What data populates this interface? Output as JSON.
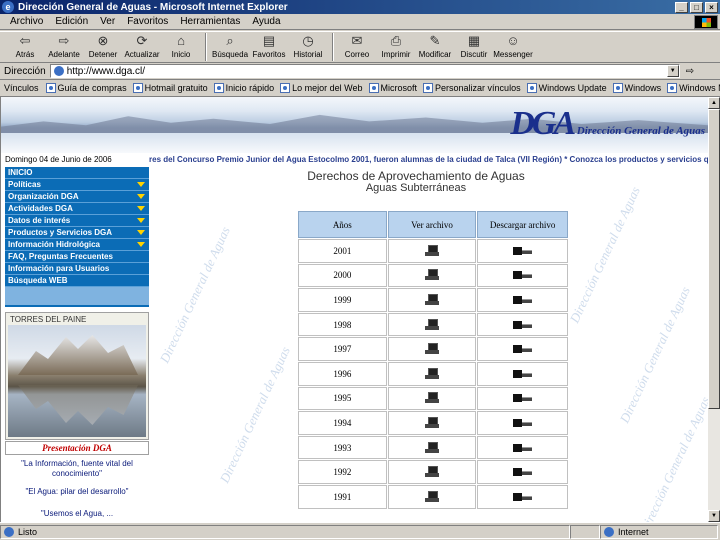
{
  "window": {
    "title": "Dirección General de Aguas - Microsoft Internet Explorer"
  },
  "menu": [
    "Archivo",
    "Edición",
    "Ver",
    "Favoritos",
    "Herramientas",
    "Ayuda"
  ],
  "toolbar": [
    {
      "label": "Atrás",
      "icon": "back-arrow-icon"
    },
    {
      "label": "Adelante",
      "icon": "forward-arrow-icon"
    },
    {
      "label": "Detener",
      "icon": "stop-icon"
    },
    {
      "label": "Actualizar",
      "icon": "refresh-icon"
    },
    {
      "label": "Inicio",
      "icon": "home-icon"
    },
    {
      "label": "Búsqueda",
      "icon": "search-icon"
    },
    {
      "label": "Favoritos",
      "icon": "favorites-icon"
    },
    {
      "label": "Historial",
      "icon": "history-icon"
    },
    {
      "label": "Correo",
      "icon": "mail-icon"
    },
    {
      "label": "Imprimir",
      "icon": "print-icon"
    },
    {
      "label": "Modificar",
      "icon": "edit-icon"
    },
    {
      "label": "Discutir",
      "icon": "discuss-icon"
    },
    {
      "label": "Messenger",
      "icon": "messenger-icon"
    }
  ],
  "address": {
    "label": "Dirección",
    "value": "http://www.dga.cl/"
  },
  "links": {
    "label": "Vínculos",
    "items": [
      "Guía de compras",
      "Hotmail gratuito",
      "Inicio rápido",
      "Lo mejor del Web",
      "Microsoft",
      "Personalizar vínculos",
      "Windows Update",
      "Windows",
      "Windows Media"
    ]
  },
  "page": {
    "logo_text": "DGA",
    "logo_sub": "Dirección General de Aguas",
    "date": "Domingo 04 de Junio de 2006",
    "ticker": "res del Concurso Premio Junior del Agua Estocolmo 2001, fueron alumnas de la ciudad de Talca (VII Región)  *  Conozca los productos y servicios que la DG",
    "nav": [
      {
        "label": "INICIO",
        "arrow": false
      },
      {
        "label": "Políticas",
        "arrow": true
      },
      {
        "label": "Organización DGA",
        "arrow": true
      },
      {
        "label": "Actividades DGA",
        "arrow": true
      },
      {
        "label": "Datos de interés",
        "arrow": true
      },
      {
        "label": "Productos y Servicios DGA",
        "arrow": true
      },
      {
        "label": "Información Hidrológica",
        "arrow": true
      },
      {
        "label": "FAQ, Preguntas Frecuentes",
        "arrow": false
      },
      {
        "label": "Información para Usuarios",
        "arrow": false
      },
      {
        "label": "Búsqueda WEB",
        "arrow": false
      }
    ],
    "photo_label": "TORRES DEL PAINE",
    "presentacion": "Presentación DGA",
    "quotes": [
      "\"La Información, fuente vital del conocimiento\"",
      "\"El Agua: pilar del desarrollo\"",
      "\"Usemos el Agua, ..."
    ],
    "watermark": "Dirección General de Aguas",
    "title": "Derechos de Aprovechamiento de Aguas",
    "subtitle": "Aguas Subterráneas",
    "table": {
      "headers": [
        "Años",
        "Ver archivo",
        "Descargar archivo"
      ],
      "years": [
        "2001",
        "2000",
        "1999",
        "1998",
        "1997",
        "1996",
        "1995",
        "1994",
        "1993",
        "1992",
        "1991"
      ]
    }
  },
  "status": {
    "left": "Listo",
    "zone": "Internet"
  }
}
